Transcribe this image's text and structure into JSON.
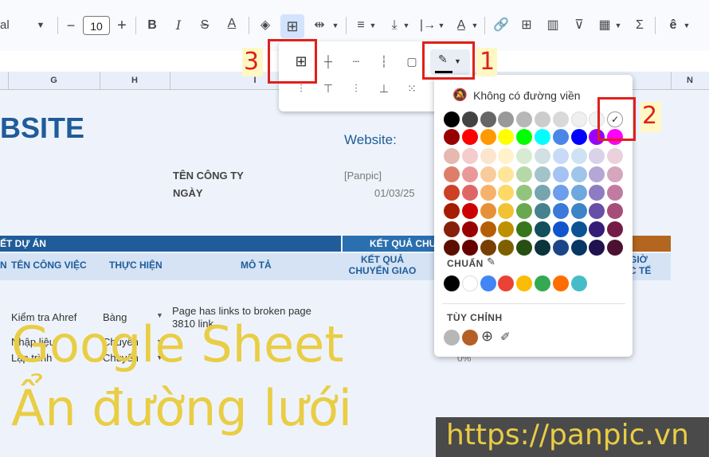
{
  "toolbar": {
    "font_name": "al",
    "font_size": "10",
    "icons": [
      "dropdown-icon",
      "minus-icon",
      "plus-icon",
      "bold-icon",
      "italic-icon",
      "strikethrough-icon",
      "text-color-icon",
      "fill-color-icon",
      "borders-icon",
      "merge-icon",
      "align-icon",
      "valign-icon",
      "text-direction-icon",
      "text-rotation-icon",
      "link-icon",
      "comment-icon",
      "chart-icon",
      "filter-icon",
      "table-view-icon",
      "functions-icon",
      "input-tools-icon"
    ]
  },
  "columns": [
    "G",
    "H",
    "I",
    "N"
  ],
  "sheet": {
    "title": "BSITE",
    "website_label": "Website:",
    "company_label": "TÊN CÔNG TY",
    "company_value": "[Panpic]",
    "date_label": "NGÀY",
    "date_value": "01/03/25",
    "header_project": "ẾT DỰ ÁN",
    "header_result": "KẾT QUẢ CHU",
    "sub_n": "N",
    "sub_task": "TÊN CÔNG VIỆC",
    "sub_owner": "THỰC HIỆN",
    "sub_desc": "MÔ TẢ",
    "sub_result": "KẾT QUẢ\nCHUYỂN GIAO",
    "sub_hours": "GIỜ\nC TẾ",
    "rows": [
      {
        "task": "Kiểm tra Ahref",
        "owner": "Bàng",
        "desc": "Page has links to broken page 3810 link"
      },
      {
        "task": "Nhập liệu",
        "owner": "Chuyên",
        "desc": ""
      },
      {
        "task": "Lập trình",
        "owner": "Chuyên",
        "desc": ""
      }
    ],
    "percent": "0%"
  },
  "color_panel": {
    "no_border": "Không có đường viền",
    "standard": "CHUẨN",
    "custom": "TÙY CHỈNH",
    "grays": [
      "#000000",
      "#434343",
      "#666666",
      "#999999",
      "#b7b7b7",
      "#cccccc",
      "#d9d9d9",
      "#efefef",
      "#f3f3f3"
    ],
    "brights": [
      "#980000",
      "#ff0000",
      "#ff9900",
      "#ffff00",
      "#00ff00",
      "#00ffff",
      "#4a86e8",
      "#0000ff",
      "#9900ff",
      "#ff00ff"
    ],
    "shades": [
      [
        "#e6b8af",
        "#f4cccc",
        "#fce5cd",
        "#fff2cc",
        "#d9ead3",
        "#d0e0e3",
        "#c9daf8",
        "#cfe2f3",
        "#d9d2e9",
        "#ead1dc"
      ],
      [
        "#dd7e6b",
        "#ea9999",
        "#f9cb9c",
        "#ffe599",
        "#b6d7a8",
        "#a2c4c9",
        "#a4c2f4",
        "#9fc5e8",
        "#b4a7d6",
        "#d5a6bd"
      ],
      [
        "#cc4125",
        "#e06666",
        "#f6b26b",
        "#ffd966",
        "#93c47d",
        "#76a5af",
        "#6d9eeb",
        "#6fa8dc",
        "#8e7cc3",
        "#c27ba0"
      ],
      [
        "#a61c00",
        "#cc0000",
        "#e69138",
        "#f1c232",
        "#6aa84f",
        "#45818e",
        "#3c78d8",
        "#3d85c6",
        "#674ea7",
        "#a64d79"
      ],
      [
        "#85200c",
        "#990000",
        "#b45f06",
        "#bf9000",
        "#38761d",
        "#134f5c",
        "#1155cc",
        "#0b5394",
        "#351c75",
        "#741b47"
      ],
      [
        "#5b0f00",
        "#660000",
        "#783f04",
        "#7f6000",
        "#274e13",
        "#0c343d",
        "#1c4587",
        "#073763",
        "#20124d",
        "#4c1130"
      ]
    ],
    "standard_colors": [
      "#000000",
      "#ffffff",
      "#4285f4",
      "#ea4335",
      "#fbbc04",
      "#34a853",
      "#ff6d01",
      "#46bdc6"
    ],
    "custom_colors": [
      "#b7b7b7",
      "#b45f26"
    ]
  },
  "annotations": {
    "n1": "1",
    "n2": "2",
    "n3": "3"
  },
  "overlay": {
    "line1": "Google Sheet",
    "line2": "Ẩn đường lưới",
    "url": "https://panpic.vn"
  }
}
